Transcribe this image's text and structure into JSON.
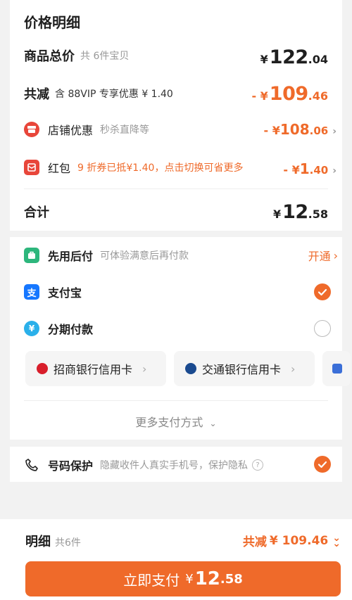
{
  "title": "价格明细",
  "goods_total": {
    "label": "商品总价",
    "count_text": "共 6件宝贝",
    "yen": "¥",
    "int": "122",
    "dec": ".04"
  },
  "total_discount": {
    "label": "共减",
    "note": "含 88VIP 专享优惠 ¥ 1.40",
    "minus": "- ¥",
    "int": "109",
    "dec": ".46"
  },
  "shop_discount": {
    "label": "店铺优惠",
    "note": "秒杀直降等",
    "minus": "- ¥",
    "int": "108",
    "dec": ".06"
  },
  "red_packet": {
    "label": "红包",
    "note": "9 折券已抵¥1.40，点击切换可省更多",
    "minus": "- ¥",
    "int": "1",
    "dec": ".40"
  },
  "sum": {
    "label": "合计",
    "yen": "¥",
    "int": "12",
    "dec": ".58"
  },
  "pay_later": {
    "label": "先用后付",
    "note": "可体验满意后再付款",
    "action": "开通"
  },
  "alipay": {
    "label": "支付宝",
    "selected": true
  },
  "installment": {
    "label": "分期付款",
    "selected": false
  },
  "banks": [
    "招商银行信用卡",
    "交通银行信用卡"
  ],
  "more_pay": "更多支付方式",
  "number_protect": {
    "label": "号码保护",
    "note": "隐藏收件人真实手机号，保护隐私",
    "selected": true
  },
  "bottom": {
    "label": "明细",
    "count": "共6件",
    "discount_label": "共减",
    "discount_value": "¥ 109.46"
  },
  "pay_button": {
    "label": "立即支付",
    "yen": "¥",
    "int": "12",
    "dec": ".58"
  },
  "colors": {
    "accent": "#ef6a2a",
    "alipay": "#1677ff",
    "red": "#e8463a"
  }
}
